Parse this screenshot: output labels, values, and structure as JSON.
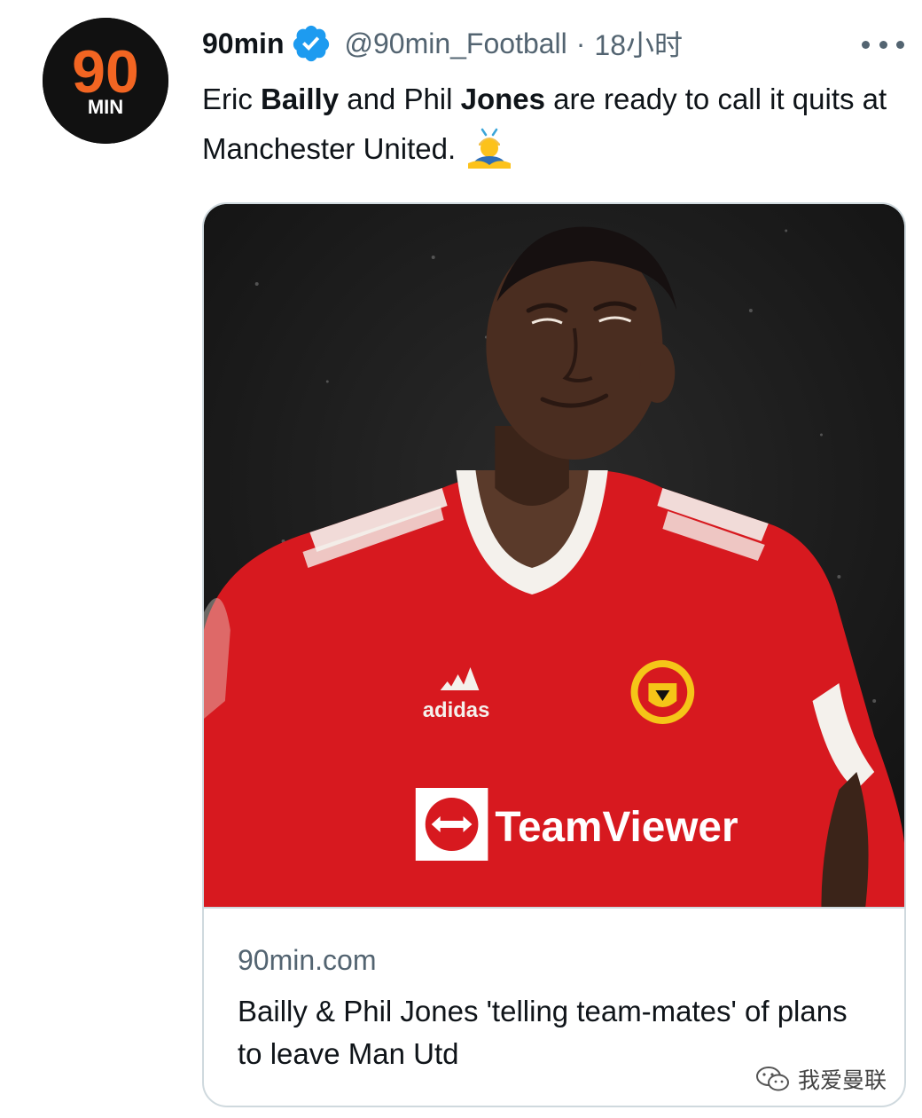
{
  "tweet": {
    "author": {
      "avatar_text_top": "90",
      "avatar_text_bottom": "MIN",
      "display_name": "90min",
      "handle": "@90min_Football",
      "separator": "·",
      "timestamp": "18小时"
    },
    "text": {
      "part1": "Eric ",
      "bold1": "Bailly",
      "part2": " and Phil ",
      "bold2": "Jones",
      "part3": " are ready to call it quits at Manchester United.",
      "emoji": "man-gesturing-emoji"
    },
    "card": {
      "image_jersey_sponsor": "TeamViewer",
      "image_jersey_brand": "adidas",
      "domain": "90min.com",
      "title": "Bailly & Phil Jones 'telling team-mates' of plans to leave Man Utd"
    },
    "colors": {
      "verified": "#1d9bf0",
      "avatar_orange": "#f26522",
      "jersey_red": "#d7191f"
    }
  },
  "watermark": {
    "text": "我爱曼联"
  }
}
